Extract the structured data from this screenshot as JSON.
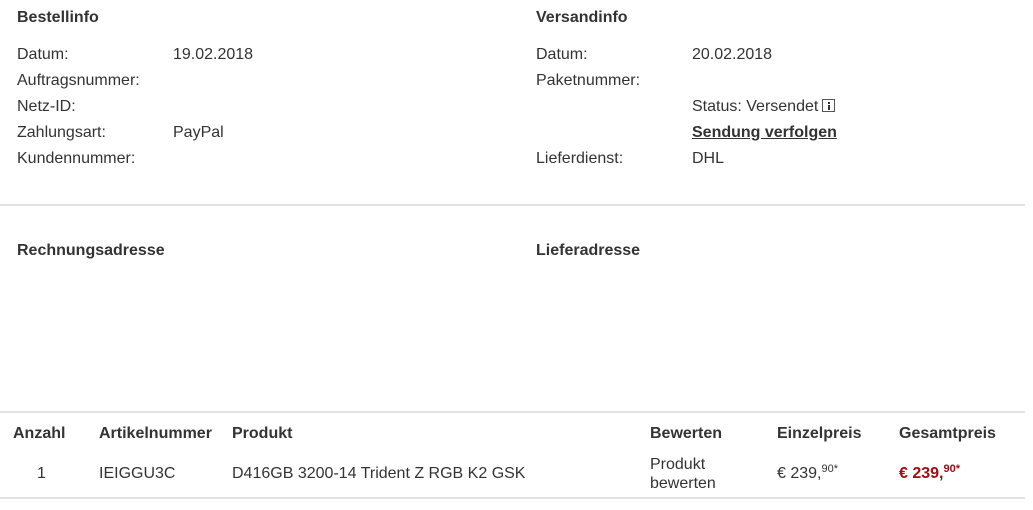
{
  "order_info": {
    "title": "Bestellinfo",
    "rows": [
      {
        "label": "Datum:",
        "value": "19.02.2018"
      },
      {
        "label": "Auftragsnummer:",
        "value": ""
      },
      {
        "label": "Netz-ID:",
        "value": ""
      },
      {
        "label": "Zahlungsart:",
        "value": "PayPal"
      },
      {
        "label": "Kundennummer:",
        "value": ""
      }
    ]
  },
  "shipping_info": {
    "title": "Versandinfo",
    "date_label": "Datum:",
    "date_value": "20.02.2018",
    "package_label": "Paketnummer:",
    "status_text": "Status: Versendet",
    "status_icon": "info-icon",
    "track_link": "Sendung verfolgen",
    "carrier_label": "Lieferdienst:",
    "carrier_value": "DHL"
  },
  "addresses": {
    "billing_title": "Rechnungsadresse",
    "delivery_title": "Lieferadresse"
  },
  "table": {
    "headers": {
      "qty": "Anzahl",
      "sku": "Artikelnummer",
      "product": "Produkt",
      "rate": "Bewerten",
      "unit": "Einzelpreis",
      "total": "Gesamtpreis"
    },
    "rows": [
      {
        "qty": "1",
        "sku": "IEIGGU3C",
        "product": "D416GB 3200-14 Trident Z RGB K2 GSK",
        "rate_line1": "Produkt",
        "rate_line2": "bewerten",
        "unit_main": "€ 239,",
        "unit_cents": "90",
        "unit_star": "*",
        "total_main": "€ 239,",
        "total_cents": "90",
        "total_star": "*"
      }
    ]
  },
  "colors": {
    "total_price": "#a10d14",
    "divider": "#e2e2e2",
    "text": "#333333"
  }
}
